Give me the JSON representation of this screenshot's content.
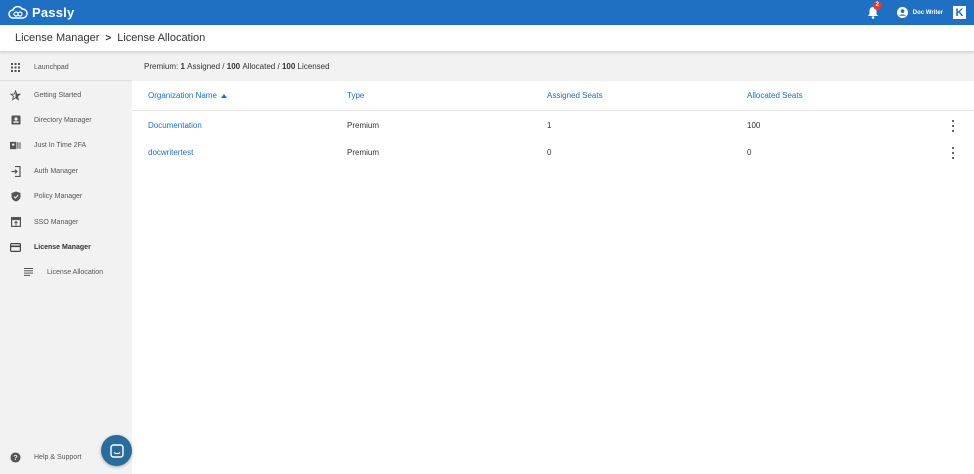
{
  "topbar": {
    "brand": "Passly",
    "notification_count": "2",
    "user_name": "Doc Writer",
    "org_logo_letter": "K"
  },
  "breadcrumb": {
    "parent": "License Manager",
    "separator": ">",
    "current": "License Allocation"
  },
  "sidebar": {
    "items": [
      {
        "label": "Launchpad",
        "icon": "grid-icon"
      },
      {
        "label": "Getting Started",
        "icon": "star-icon"
      },
      {
        "label": "Directory Manager",
        "icon": "contact-card-icon"
      },
      {
        "label": "Just In Time 2FA",
        "icon": "badge-icon"
      },
      {
        "label": "Auth Manager",
        "icon": "login-icon"
      },
      {
        "label": "Policy Manager",
        "icon": "shield-icon"
      },
      {
        "label": "SSO Manager",
        "icon": "sso-icon"
      },
      {
        "label": "License Manager",
        "icon": "credit-card-icon"
      },
      {
        "label": "License Allocation",
        "icon": "list-icon"
      }
    ],
    "help_label": "Help & Support"
  },
  "summary": {
    "tier": "Premium:",
    "assigned_count": "1",
    "assigned_label": "Assigned /",
    "allocated_count": "100",
    "allocated_label": "Allocated /",
    "licensed_count": "100",
    "licensed_label": "Licensed"
  },
  "table": {
    "headers": [
      "Organization Name",
      "Type",
      "Assigned Seats",
      "Allocated Seats"
    ],
    "rows": [
      {
        "org": "Documentation",
        "type": "Premium",
        "assigned": "1",
        "allocated": "100"
      },
      {
        "org": "docwritertest",
        "type": "Premium",
        "assigned": "0",
        "allocated": "0"
      }
    ]
  },
  "colors": {
    "brand_blue": "#1f6fc2",
    "sidebar_bg": "#f2f2f2",
    "badge_red": "#e53935",
    "chat_button": "#2a6d9a"
  }
}
